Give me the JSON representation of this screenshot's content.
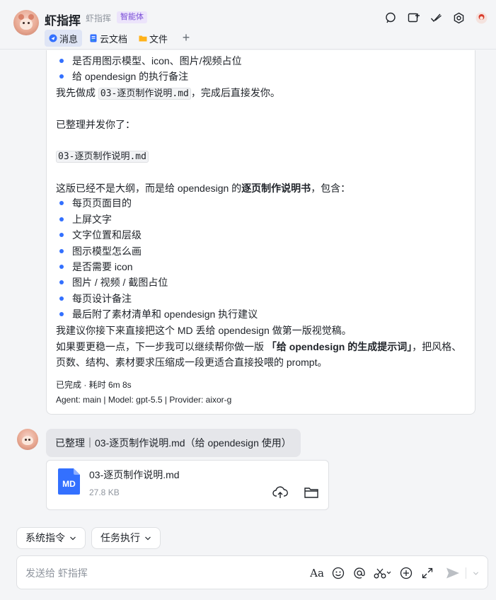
{
  "header": {
    "title": "虾指挥",
    "subtitle": "虾指挥",
    "badge": "智能体",
    "tabs": [
      {
        "label": "消息"
      },
      {
        "label": "云文档"
      },
      {
        "label": "文件"
      }
    ],
    "add_tab": "+"
  },
  "message1": {
    "bullets_top": [
      "是否用图示模型、icon、图片/视频占位",
      "给 opendesign 的执行备注"
    ],
    "line_prefix": "我先做成 ",
    "line_code": "03-逐页制作说明.md",
    "line_suffix": "，完成后直接发你。",
    "done_line": "已整理并发你了：",
    "file_code": "03-逐页制作说明.md",
    "intro_prefix": "这版已经不是大纲，而是给 opendesign 的",
    "intro_bold": "逐页制作说明书",
    "intro_suffix": "，包含：",
    "bullets": [
      "每页页面目的",
      "上屏文字",
      "文字位置和层级",
      "图示模型怎么画",
      "是否需要 icon",
      "图片 / 视频 / 截图占位",
      "每页设计备注",
      "最后附了素材清单和 opendesign 执行建议"
    ],
    "suggest_line": "我建议你接下来直接把这个 MD 丢给 opendesign 做第一版视觉稿。",
    "more_prefix": "如果要更稳一点，下一步我可以继续帮你做一版 ",
    "more_bold": "「给 opendesign 的生成提示词」",
    "more_suffix": "，把风格、",
    "more_line2": "页数、结构、素材要求压缩成一段更适合直接投喂的 prompt。",
    "status": "已完成 · 耗时 6m 8s",
    "agent_info": "Agent: main | Model: gpt-5.5 | Provider: aixor-g"
  },
  "message2": {
    "text": "已整理｜03-逐页制作说明.md（给 opendesign 使用）"
  },
  "file": {
    "type_label": "MD",
    "name": "03-逐页制作说明.md",
    "size": "27.8 KB"
  },
  "chips": [
    {
      "label": "系统指令"
    },
    {
      "label": "任务执行"
    }
  ],
  "composer": {
    "placeholder": "发送给 虾指挥",
    "font_icon_label": "Aa"
  },
  "colors": {
    "accent": "#3370ff",
    "file_icon": "#3370ff",
    "badge_bg": "#ece4fb",
    "badge_text": "#7a4fd6"
  }
}
